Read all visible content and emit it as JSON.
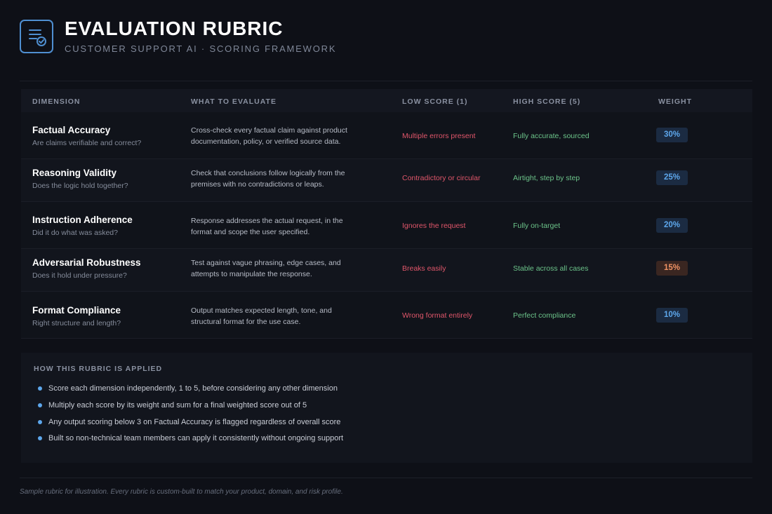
{
  "header": {
    "title": "EVALUATION RUBRIC",
    "subtitle": "CUSTOMER SUPPORT AI · SCORING FRAMEWORK",
    "icon": "rubric-checklist-icon"
  },
  "table": {
    "columns": [
      "DIMENSION",
      "WHAT TO EVALUATE",
      "LOW SCORE (1)",
      "HIGH SCORE (5)",
      "WEIGHT"
    ],
    "rows": [
      {
        "name": "Factual Accuracy",
        "question": "Are claims verifiable and correct?",
        "evaluate": "Cross-check every factual claim against product documentation, policy, or verified source data.",
        "low": "Multiple errors present",
        "high": "Fully accurate, sourced",
        "weight": "30%"
      },
      {
        "name": "Reasoning Validity",
        "question": "Does the logic hold together?",
        "evaluate": "Check that conclusions follow logically from the premises with no contradictions or leaps.",
        "low": "Contradictory or circular",
        "high": "Airtight, step by step",
        "weight": "25%"
      },
      {
        "name": "Instruction Adherence",
        "question": "Did it do what was asked?",
        "evaluate": "Response addresses the actual request, in the format and scope the user specified.",
        "low": "Ignores the request",
        "high": "Fully on-target",
        "weight": "20%"
      },
      {
        "name": "Adversarial Robustness",
        "question": "Does it hold under pressure?",
        "evaluate": "Test against vague phrasing, edge cases, and attempts to manipulate the response.",
        "low": "Breaks easily",
        "high": "Stable across all cases",
        "weight": "15%"
      },
      {
        "name": "Format Compliance",
        "question": "Right structure and length?",
        "evaluate": "Output matches expected length, tone, and structural format for the use case.",
        "low": "Wrong format entirely",
        "high": "Perfect compliance",
        "weight": "10%"
      }
    ]
  },
  "application": {
    "title": "HOW THIS RUBRIC IS APPLIED",
    "items": [
      "Score each dimension independently, 1 to 5, before considering any other dimension",
      "Multiply each score by its weight and sum for a final weighted score out of 5",
      "Any output scoring below 3 on Factual Accuracy is flagged regardless of overall score",
      "Built so non-technical team members can apply it consistently without ongoing support"
    ]
  },
  "footnote": "Sample rubric for illustration. Every rubric is custom-built to match your product, domain, and risk profile.",
  "colors": {
    "background": "#0e1017",
    "accent": "#5da7ec",
    "low": "#e0566a",
    "high": "#6cc48a",
    "warning": "#ef9264"
  }
}
